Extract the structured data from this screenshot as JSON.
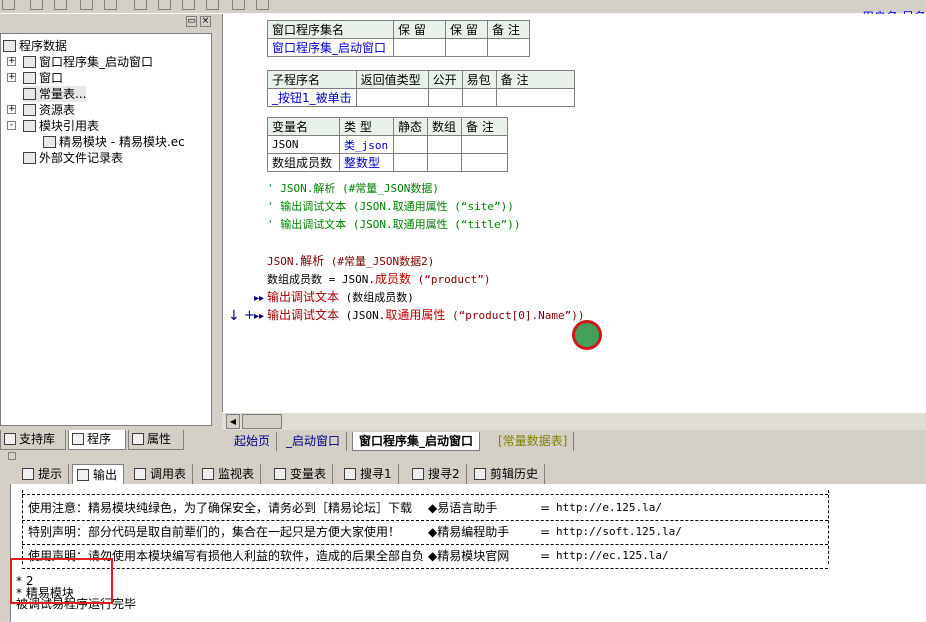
{
  "user_label": "用户名:吴名",
  "tree": {
    "root": "程序数据",
    "items": [
      {
        "label": "窗口程序集_启动窗口",
        "exp": "+"
      },
      {
        "label": "窗口",
        "exp": "+"
      },
      {
        "label": "常量表...",
        "exp": ""
      },
      {
        "label": "资源表",
        "exp": "+"
      },
      {
        "label": "模块引用表",
        "exp": "-"
      },
      {
        "label": "精易模块 - 精易模块.ec",
        "exp": ""
      },
      {
        "label": "外部文件记录表",
        "exp": ""
      }
    ]
  },
  "left_tabs": [
    "支持库",
    "程序",
    "属性"
  ],
  "editor": {
    "assembly_table": {
      "headers": [
        "窗口程序集名",
        "保 留",
        "保 留",
        "备 注"
      ],
      "row": [
        "窗口程序集_启动窗口",
        "",
        "",
        ""
      ]
    },
    "sub_table": {
      "headers": [
        "子程序名",
        "返回值类型",
        "公开",
        "易包",
        "备 注"
      ],
      "row": [
        "_按钮1_被单击",
        "",
        "",
        "",
        ""
      ]
    },
    "var_table": {
      "headers": [
        "变量名",
        "类 型",
        "静态",
        "数组",
        "备 注"
      ],
      "rows": [
        [
          "JSON",
          "类_json",
          "",
          "",
          ""
        ],
        [
          "数组成员数",
          "整数型",
          "",
          "",
          ""
        ]
      ]
    },
    "comments": [
      "' JSON.解析 (#常量_JSON数据)",
      "' 输出调试文本 (JSON.取通用属性 (“site”))",
      "' 输出调试文本 (JSON.取通用属性 (“title”))"
    ],
    "code": {
      "l1_obj": "JSON.",
      "l1_fn": "解析",
      "l1_rest": " (#常量_JSON数据2)",
      "l2_var": "数组成员数 = JSON.",
      "l2_fn": "成员数",
      "l2_rest": " (“product”)",
      "l3_fn": "输出调试文本",
      "l3_rest": " (数组成员数)",
      "l4_fn": "输出调试文本",
      "l4_mid": " (JSON.",
      "l4_fn2": "取通用属性",
      "l4_rest": " (“product[0].Name”))"
    }
  },
  "editor_tabs": [
    "起始页",
    "_启动窗口",
    "窗口程序集_启动窗口",
    "[常量数据表]"
  ],
  "output_tabs": [
    "提示",
    "输出",
    "调用表",
    "监视表",
    "变量表",
    "搜寻1",
    "搜寻2",
    "剪辑历史"
  ],
  "output": {
    "rows": [
      {
        "left": "使用注意：精易模块纯绿色，为了确保安全，请务必到［精易论坛］下载",
        "mid": "◆易语言助手",
        "eq": "=",
        "url": "http://e.125.la/"
      },
      {
        "left": "特别声明：部分代码是取自前辈们的，集合在一起只是方便大家使用！",
        "mid": "◆精易编程助手",
        "eq": "=",
        "url": "http://soft.125.la/"
      },
      {
        "left": "使用声明：请勿使用本模块编写有损他人利益的软件，造成的后果全部自负",
        "mid": "◆精易模块官网",
        "eq": "=",
        "url": "http://ec.125.la/"
      }
    ],
    "lines": [
      "* 2",
      "* 精易模块",
      "被调试易程序运行完毕"
    ]
  }
}
